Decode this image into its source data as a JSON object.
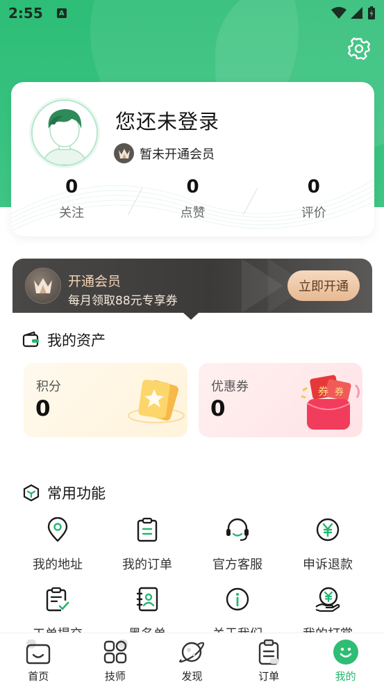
{
  "status_bar": {
    "time": "2:55",
    "notif_icon_letter": "A"
  },
  "header": {
    "settings_icon": "gear-icon"
  },
  "profile": {
    "title": "您还未登录",
    "member_status": "暂未开通会员",
    "stats": [
      {
        "value": "0",
        "label": "关注"
      },
      {
        "value": "0",
        "label": "点赞"
      },
      {
        "value": "0",
        "label": "评价"
      }
    ]
  },
  "vip": {
    "title": "开通会员",
    "subtitle": "每月领取88元专享券",
    "button": "立即开通"
  },
  "assets": {
    "title": "我的资产",
    "items": [
      {
        "label": "积分",
        "value": "0"
      },
      {
        "label": "优惠券",
        "value": "0"
      }
    ],
    "coupon_tag": "券"
  },
  "functions": {
    "title": "常用功能",
    "items": [
      {
        "label": "我的地址",
        "icon": "location-pin-icon"
      },
      {
        "label": "我的订单",
        "icon": "clipboard-list-icon"
      },
      {
        "label": "官方客服",
        "icon": "headset-icon"
      },
      {
        "label": "申诉退款",
        "icon": "yen-refund-icon"
      },
      {
        "label": "工单提交",
        "icon": "clipboard-check-icon"
      },
      {
        "label": "黑名单",
        "icon": "contact-book-icon"
      },
      {
        "label": "关于我们",
        "icon": "info-icon"
      },
      {
        "label": "我的打赏",
        "icon": "yen-hand-icon"
      }
    ]
  },
  "tabbar": {
    "items": [
      {
        "label": "首页",
        "icon": "home-icon"
      },
      {
        "label": "技师",
        "icon": "grid-icon"
      },
      {
        "label": "发现",
        "icon": "planet-icon"
      },
      {
        "label": "订单",
        "icon": "clipboard-icon"
      },
      {
        "label": "我的",
        "icon": "smile-icon",
        "active": true
      }
    ]
  },
  "colors": {
    "brand": "#2dbd76",
    "accent_gold": "#e7b993",
    "active_tab": "#26b56f"
  }
}
